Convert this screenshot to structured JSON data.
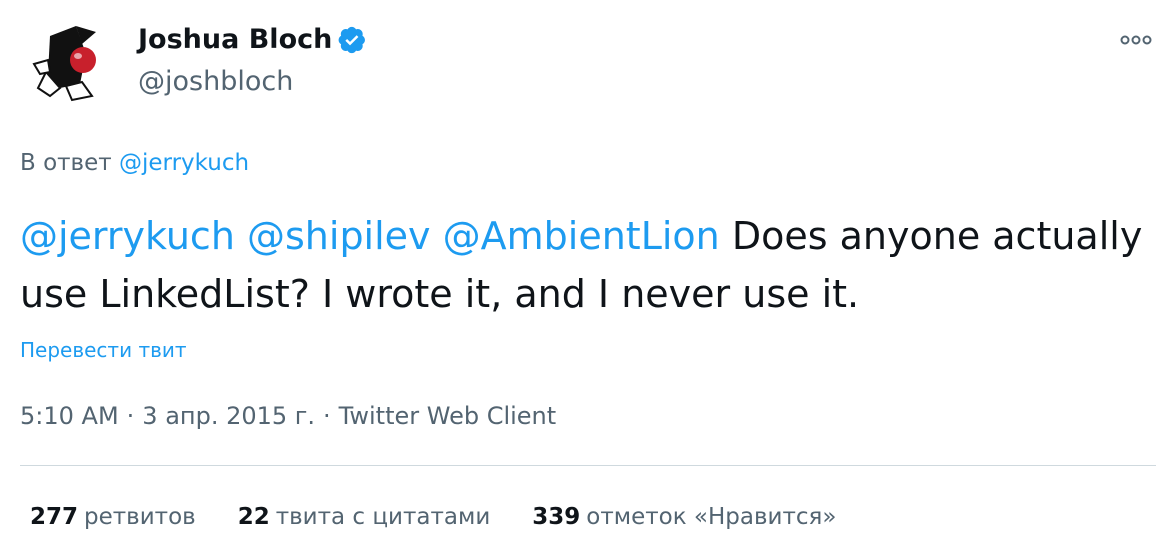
{
  "author": {
    "name": "Joshua Bloch",
    "handle": "@joshbloch",
    "verified": true
  },
  "reply": {
    "prefix": "В ответ",
    "to": "@jerrykuch"
  },
  "tweet": {
    "mentions": [
      "@jerrykuch",
      "@shipilev",
      "@AmbientLion"
    ],
    "text": "Does anyone actually use LinkedList?  I wrote it, and I never use it.",
    "translate_label": "Перевести твит"
  },
  "meta": {
    "time": "5:10 AM",
    "date": "3 апр. 2015 г.",
    "separator": "·",
    "source": "Twitter Web Client"
  },
  "stats": {
    "retweets_count": "277",
    "retweets_label": "ретвитов",
    "quotes_count": "22",
    "quotes_label": "твита с цитатами",
    "likes_count": "339",
    "likes_label": "отметок «Нравится»"
  },
  "colors": {
    "accent": "#1d9bf0",
    "text_primary": "#0f1419",
    "text_secondary": "#536471",
    "divider": "#cfd9de"
  },
  "icons": {
    "avatar": "duke-mascot-avatar",
    "verified": "verified-badge-icon",
    "more": "more-options-icon"
  }
}
